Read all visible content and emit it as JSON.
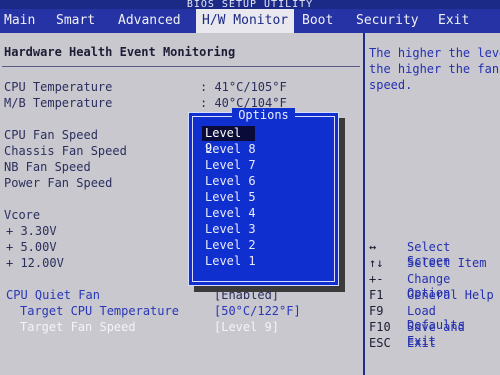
{
  "title": "BIOS SETUP UTILITY",
  "menu": [
    "Main",
    "Smart",
    "Advanced",
    "H/W Monitor",
    "Boot",
    "Security",
    "Exit"
  ],
  "section_title": "Hardware Health Event Monitoring",
  "temps": [
    {
      "label": "CPU Temperature",
      "value": ": 41°C/105°F"
    },
    {
      "label": "M/B Temperature",
      "value": ": 40°C/104°F"
    }
  ],
  "fans": [
    "CPU Fan Speed",
    "Chassis Fan Speed",
    "NB Fan Speed",
    "Power Fan Speed"
  ],
  "voltages": {
    "title": "Vcore",
    "items": [
      "+ 3.30V",
      "+ 5.00V",
      "+ 12.00V"
    ]
  },
  "settings": [
    {
      "label": "CPU Quiet Fan",
      "value": "[Enabled]"
    },
    {
      "label": "Target CPU Temperature",
      "value": "[50°C/122°F]"
    },
    {
      "label": "Target Fan Speed",
      "value": "[Level 9]"
    }
  ],
  "popup": {
    "title": "Options",
    "options": [
      "Level 9",
      "Level 8",
      "Level 7",
      "Level 6",
      "Level 5",
      "Level 4",
      "Level 3",
      "Level 2",
      "Level 1"
    ],
    "selected": "Level 9"
  },
  "help": {
    "lines": [
      "The higher the leve",
      "the higher the fan",
      "speed."
    ],
    "keys": [
      {
        "key": "↔",
        "desc": "Select Screen"
      },
      {
        "key": "↑↓",
        "desc": "Select Item"
      },
      {
        "key": "+-",
        "desc": "Change Option"
      },
      {
        "key": "F1",
        "desc": "General Help"
      },
      {
        "key": "F9",
        "desc": "Load Defaults"
      },
      {
        "key": "F10",
        "desc": "Save and Exit"
      },
      {
        "key": "ESC",
        "desc": "Exit"
      }
    ]
  },
  "colors": {
    "menubar": "#2533a5",
    "panel": "#c8c8ce",
    "popup": "#0f2fcf",
    "help_text": "#2530b0"
  }
}
